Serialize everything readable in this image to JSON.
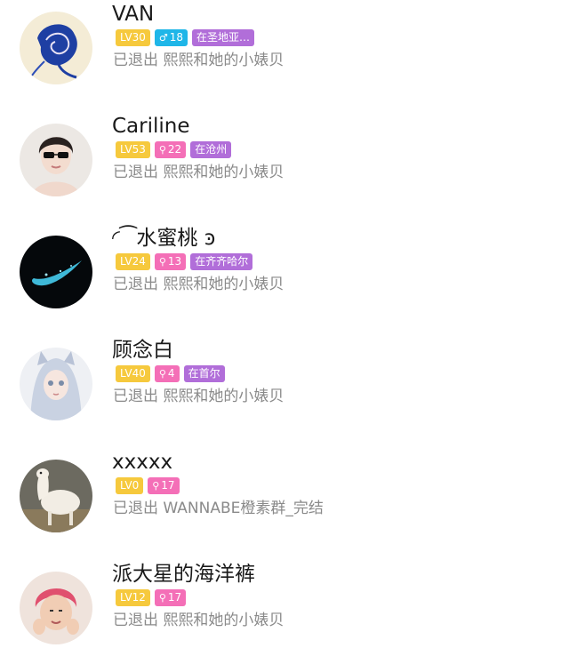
{
  "members": [
    {
      "name": "VAN",
      "level": "LV30",
      "gender_icon": "male-icon",
      "gender_symbol": "♂",
      "age": "18",
      "location": "在圣地亚…",
      "status": "已退出 熙熙和她的小婊贝"
    },
    {
      "name": "Cariline",
      "level": "LV53",
      "gender_icon": "female-icon",
      "gender_symbol": "⚲",
      "age": "22",
      "location": "在沧州",
      "status": "已退出 熙熙和她的小婊贝"
    },
    {
      "name": "◜⁀水蜜桃 ͽ",
      "level": "LV24",
      "gender_icon": "female-icon",
      "gender_symbol": "⚲",
      "age": "13",
      "location": "在齐齐哈尔",
      "status": "已退出 熙熙和她的小婊贝"
    },
    {
      "name": "顾念白",
      "level": "LV40",
      "gender_icon": "female-icon",
      "gender_symbol": "⚲",
      "age": "4",
      "location": "在首尔",
      "status": "已退出 熙熙和她的小婊贝"
    },
    {
      "name": "xxxxx",
      "level": "LV0",
      "gender_icon": "female-icon",
      "gender_symbol": "⚲",
      "age": "17",
      "location": "",
      "status": "已退出 WANNABE橙素群_完结"
    },
    {
      "name": "派大星的海洋裤",
      "level": "LV12",
      "gender_icon": "female-icon",
      "gender_symbol": "⚲",
      "age": "17",
      "location": "",
      "status": "已退出 熙熙和她的小婊贝"
    }
  ],
  "colors": {
    "level_badge": "#f6c93d",
    "male_badge": "#1fb6e8",
    "female_badge": "#f46fb7",
    "location_badge": "#b16ed9",
    "status_text": "#8a8a8a"
  }
}
